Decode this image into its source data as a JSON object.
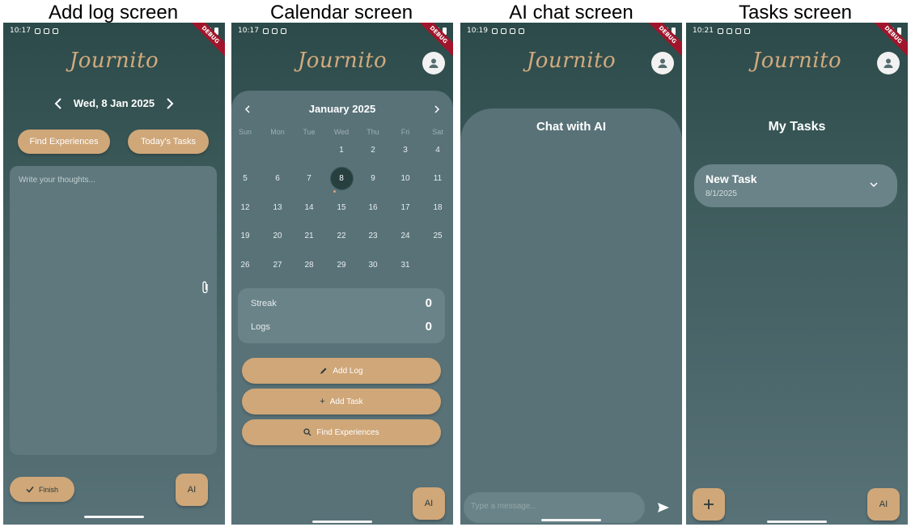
{
  "captions": [
    "Add log screen",
    "Calendar screen",
    "AI chat screen",
    "Tasks screen"
  ],
  "app_name": "Journito",
  "debug_label": "DEBUG",
  "ai_label": "AI",
  "add_log": {
    "time": "10:17",
    "date": "Wed, 8 Jan 2025",
    "find_experiences": "Find Experiences",
    "todays_tasks": "Today's Tasks",
    "placeholder": "Write your thoughts...",
    "finish": "Finish"
  },
  "calendar": {
    "time": "10:17",
    "month": "January 2025",
    "weekdays": [
      "Sun",
      "Mon",
      "Tue",
      "Wed",
      "Thu",
      "Fri",
      "Sat"
    ],
    "weeks": [
      [
        "",
        "",
        "",
        "1",
        "2",
        "3",
        "4"
      ],
      [
        "5",
        "6",
        "7",
        "8",
        "9",
        "10",
        "11"
      ],
      [
        "12",
        "13",
        "14",
        "15",
        "16",
        "17",
        "18"
      ],
      [
        "19",
        "20",
        "21",
        "22",
        "23",
        "24",
        "25"
      ],
      [
        "26",
        "27",
        "28",
        "29",
        "30",
        "31",
        ""
      ]
    ],
    "selected_day": "8",
    "streak_label": "Streak",
    "streak_value": "0",
    "logs_label": "Logs",
    "logs_value": "0",
    "add_log": "Add Log",
    "add_task": "Add Task",
    "find_experiences": "Find Experiences"
  },
  "chat": {
    "time": "10:19",
    "title": "Chat with AI",
    "placeholder": "Type a message..."
  },
  "tasks": {
    "time": "10:21",
    "title": "My Tasks",
    "task_title": "New Task",
    "task_date": "8/1/2025"
  },
  "colors": {
    "accent": "#cfa779",
    "panel": "#587278",
    "bg_dark": "#2c4a49",
    "selected_day": "#27403f",
    "debug_banner": "#a0152b"
  },
  "icons": [
    "chevron-left-icon",
    "chevron-right-icon",
    "paperclip-icon",
    "check-icon",
    "pencil-icon",
    "plus-icon",
    "search-icon",
    "send-icon",
    "person-icon",
    "chevron-down-icon"
  ]
}
